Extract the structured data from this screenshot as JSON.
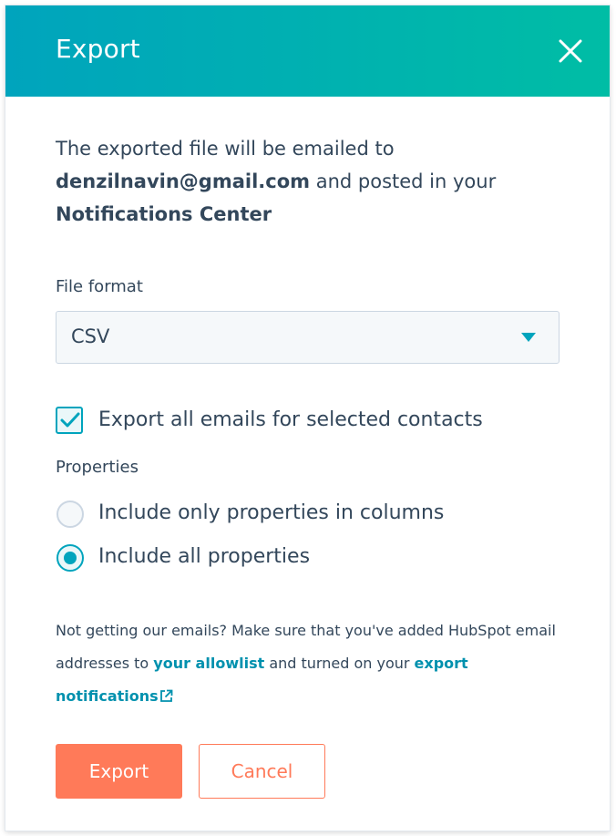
{
  "dialog": {
    "title": "Export",
    "intro_prefix": "The exported file will be emailed to",
    "email": "denzilnavin@gmail.com",
    "intro_middle": "and posted in your",
    "notifications_center": "Notifications Center"
  },
  "file_format": {
    "label": "File format",
    "selected": "CSV"
  },
  "export_all_emails": {
    "label": "Export all emails for selected contacts",
    "checked": true
  },
  "properties": {
    "label": "Properties",
    "options": [
      {
        "label": "Include only properties in columns",
        "selected": false
      },
      {
        "label": "Include all properties",
        "selected": true
      }
    ]
  },
  "note": {
    "part1": "Not getting our emails? Make sure that you've added HubSpot email addresses to",
    "link1": "your allowlist",
    "part2": "and turned on your",
    "link2": "export notifications"
  },
  "buttons": {
    "export": "Export",
    "cancel": "Cancel"
  },
  "colors": {
    "header_gradient_start": "#00a4bd",
    "header_gradient_end": "#00bda5",
    "primary_button": "#ff7a59",
    "link": "#0091ae",
    "text": "#33475b"
  },
  "icons": {
    "close": "close-icon",
    "caret": "caret-down-icon",
    "check": "checkmark-icon",
    "external_link": "external-link-icon"
  }
}
